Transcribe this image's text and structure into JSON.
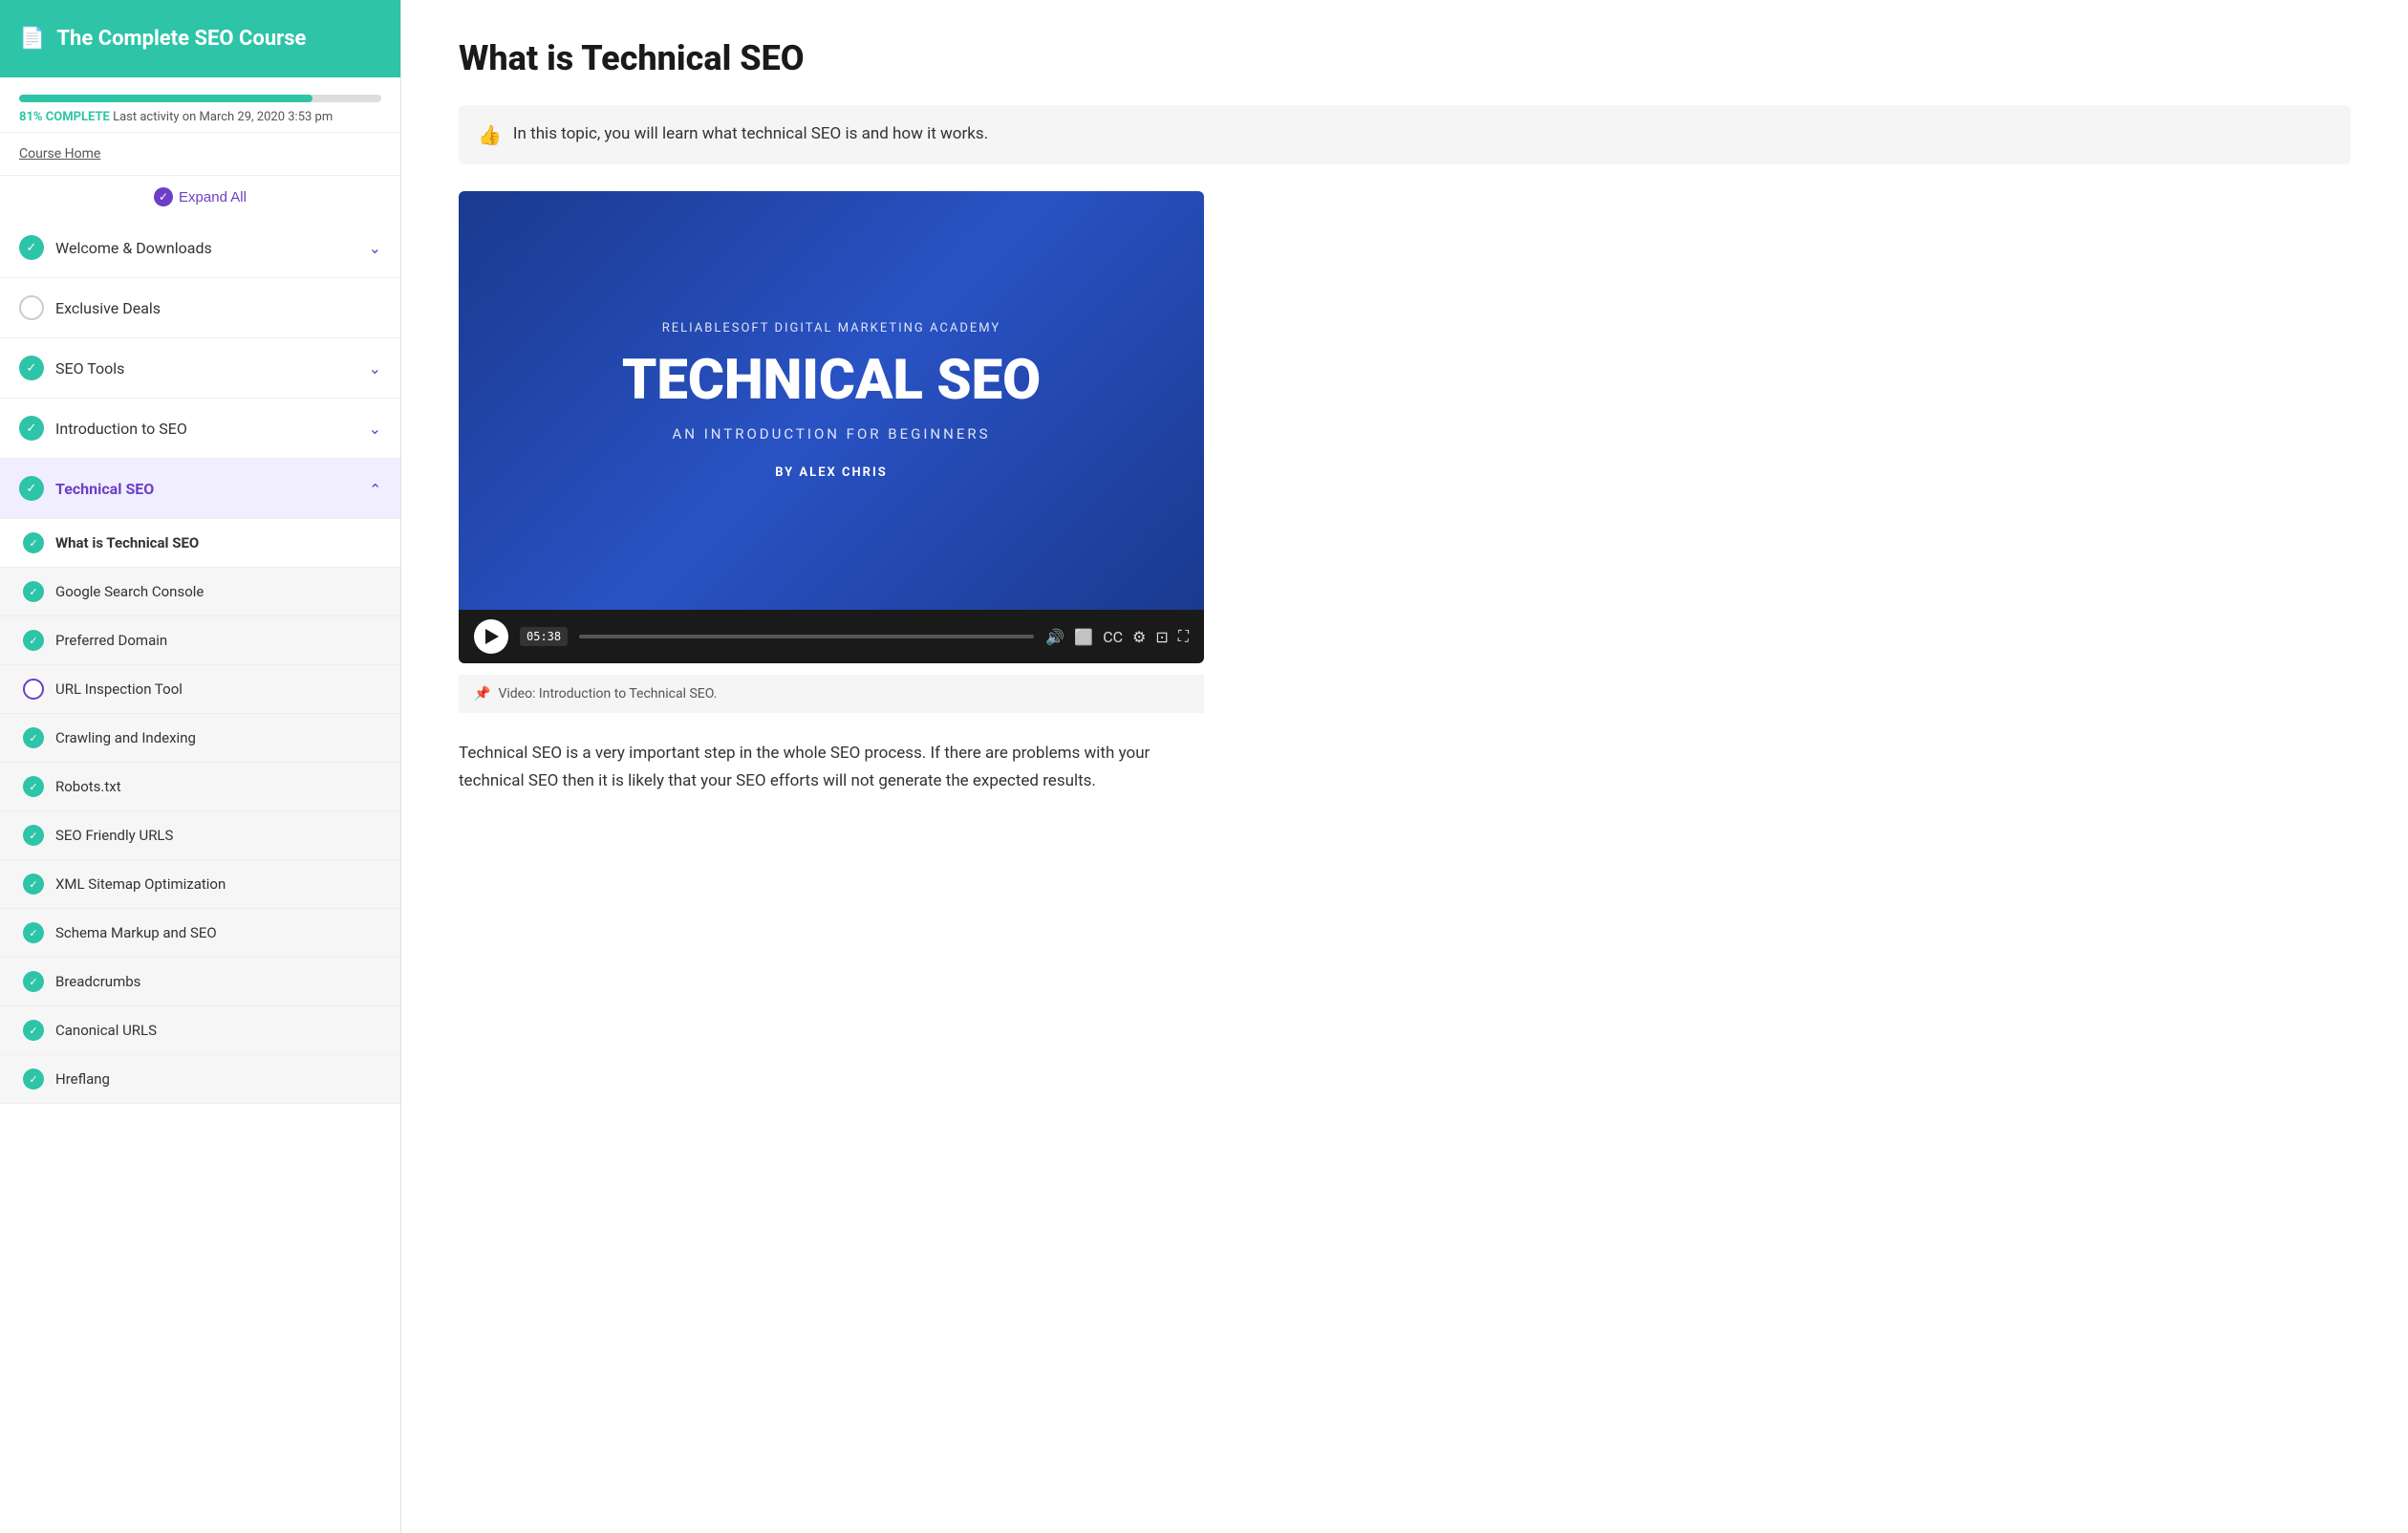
{
  "sidebar": {
    "header": {
      "title": "The Complete SEO Course",
      "icon": "📄"
    },
    "progress": {
      "percent": 81,
      "label": "81% COMPLETE",
      "activity": "Last activity on March 29, 2020 3:53 pm"
    },
    "course_home_label": "Course Home",
    "expand_all_label": "Expand All",
    "sections": [
      {
        "id": "welcome",
        "title": "Welcome & Downloads",
        "completed": true,
        "expanded": false,
        "lessons": []
      },
      {
        "id": "exclusive",
        "title": "Exclusive Deals",
        "completed": false,
        "expanded": false,
        "lessons": []
      },
      {
        "id": "seo-tools",
        "title": "SEO Tools",
        "completed": true,
        "expanded": false,
        "lessons": []
      },
      {
        "id": "intro-seo",
        "title": "Introduction to SEO",
        "completed": true,
        "expanded": false,
        "lessons": []
      },
      {
        "id": "technical-seo",
        "title": "Technical SEO",
        "completed": true,
        "expanded": true,
        "active": true,
        "lessons": [
          {
            "id": "what-is",
            "title": "What is Technical SEO",
            "completed": true,
            "active": true
          },
          {
            "id": "gsc",
            "title": "Google Search Console",
            "completed": true,
            "active": false
          },
          {
            "id": "preferred-domain",
            "title": "Preferred Domain",
            "completed": true,
            "active": false
          },
          {
            "id": "url-inspection",
            "title": "URL Inspection Tool",
            "completed": false,
            "active": false
          },
          {
            "id": "crawling",
            "title": "Crawling and Indexing",
            "completed": true,
            "active": false
          },
          {
            "id": "robots",
            "title": "Robots.txt",
            "completed": true,
            "active": false
          },
          {
            "id": "seo-friendly",
            "title": "SEO Friendly URLS",
            "completed": true,
            "active": false
          },
          {
            "id": "xml-sitemap",
            "title": "XML Sitemap Optimization",
            "completed": true,
            "active": false
          },
          {
            "id": "schema",
            "title": "Schema Markup and SEO",
            "completed": true,
            "active": false
          },
          {
            "id": "breadcrumbs",
            "title": "Breadcrumbs",
            "completed": true,
            "active": false
          },
          {
            "id": "canonical",
            "title": "Canonical URLS",
            "completed": true,
            "active": false
          },
          {
            "id": "hreflang",
            "title": "Hreflang",
            "completed": true,
            "active": false
          }
        ]
      }
    ]
  },
  "main": {
    "title": "What is Technical SEO",
    "info_text": "In this topic, you will learn what technical SEO is and how it works.",
    "video": {
      "academy": "RELIABLESOFT DIGITAL MARKETING ACADEMY",
      "main_title": "TECHNICAL SEO",
      "subtitle": "AN INTRODUCTION FOR BEGINNERS",
      "author_prefix": "BY",
      "author": "ALEX CHRIS",
      "time": "05:38"
    },
    "video_caption": "Video: Introduction to Technical SEO.",
    "body_text": "Technical SEO is a very important step in the whole SEO process. If there are problems with your technical SEO then it is likely that your SEO efforts will not generate the expected results."
  }
}
